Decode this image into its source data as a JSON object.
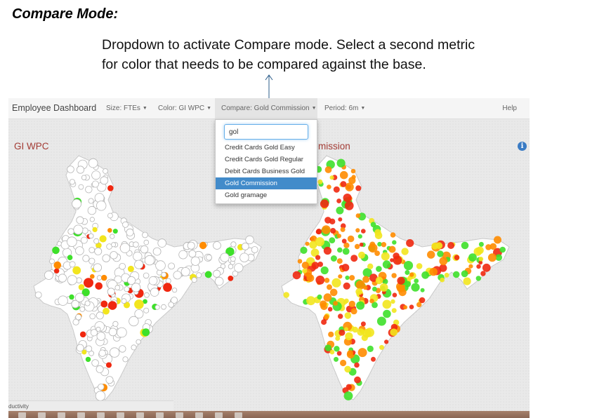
{
  "doc": {
    "heading": "Compare Mode:",
    "callout_line1": "Dropdown to activate Compare mode. Select a second metric",
    "callout_line2": "for color that needs to be compared against the base."
  },
  "navbar": {
    "brand": "Employee Dashboard",
    "size": "Size: FTEs",
    "color": "Color: GI WPC",
    "compare": "Compare: Gold Commission",
    "period": "Period: 6m",
    "help": "Help"
  },
  "dropdown": {
    "search_value": "gol",
    "items": [
      "Credit Cards Gold Easy",
      "Credit Cards Gold Regular",
      "Debit Cards Business Gold",
      "Gold Commission",
      "Gold gramage"
    ],
    "selected_index": 3
  },
  "panels": {
    "left_title": "GI WPC",
    "right_title": "mission"
  },
  "status_text": "ductivity",
  "colors": {
    "panel_title": "#a33b34",
    "accent": "#428bca",
    "bubble_green": "#3ee02a",
    "bubble_red": "#f02810",
    "bubble_orange": "#ff8c00",
    "bubble_yellow": "#f2e51e"
  },
  "icons": {
    "info": "info-icon",
    "caret": "caret-down-icon",
    "arrow": "arrow-up-icon"
  }
}
